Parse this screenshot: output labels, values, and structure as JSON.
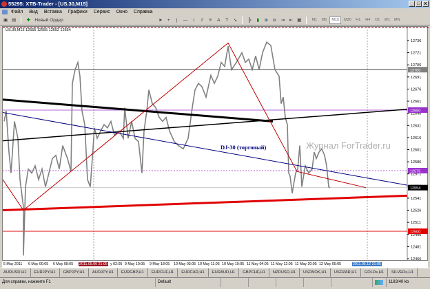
{
  "window": {
    "title": "55295: XTB-Trader - [US.30,M15]",
    "min": "_",
    "max": "□",
    "close": "x"
  },
  "menu": [
    "Файл",
    "Вид",
    "Вставка",
    "Графики",
    "Сервис",
    "Окно",
    "Справка"
  ],
  "toolbar": {
    "new_order": "Новый Ордер",
    "timeframes": [
      "M1",
      "M5",
      "M15",
      "M30",
      "H1",
      "H4",
      "D1",
      "W1",
      "MN"
    ],
    "active_timeframe": "M15"
  },
  "chart": {
    "symbol_info": "US.30,M15  12555 12555 12552 12554",
    "instrument_label": "DJ-30 (торговый)",
    "watermark": "Журнал ForTrader.ru",
    "price_axis": [
      "12736",
      "12721",
      "12706",
      "12691",
      "12676",
      "12661",
      "12646",
      "12631",
      "12616",
      "12601",
      "12586",
      "12571",
      "12556",
      "12541",
      "12526",
      "12511",
      "12496",
      "12481",
      "12466"
    ],
    "price_range": [
      12466,
      12736
    ],
    "level_markers": [
      {
        "price": 12700,
        "label": "12700",
        "color": "#808080",
        "style": "solid"
      },
      {
        "price": 12650,
        "label": "12650",
        "color": "#9932cc",
        "style": "solid"
      },
      {
        "price": 12575,
        "label": "12575",
        "color": "#9932cc",
        "style": "dotted"
      },
      {
        "price": 12554,
        "label": "12554",
        "color": "#c0c0c0",
        "style": "solid",
        "marker": "#000000"
      },
      {
        "price": 12500,
        "label": "12500",
        "color": "#e00000",
        "style": "solid"
      }
    ],
    "time_labels": [
      "5 May 2011",
      "6 May 00:05",
      "6 May 08:05",
      "2011.05.06 21:05",
      "y 02:05",
      "9 May 10:05",
      "9 May 18:05",
      "10 May 03:05",
      "10 May 11:05",
      "10 May 19:05",
      "11 May 04:05",
      "11 May 12:05",
      "11 May 20:05",
      "12 May 05:05",
      "2011.05.12 21:05"
    ],
    "bar_span": 587,
    "vertical_lines": [
      132,
      529
    ],
    "price_series": [
      [
        2,
        12636
      ],
      [
        5,
        12649
      ],
      [
        9,
        12598
      ],
      [
        12,
        12572
      ],
      [
        17,
        12636
      ],
      [
        22,
        12615
      ],
      [
        25,
        12564
      ],
      [
        30,
        12530
      ],
      [
        30,
        12470
      ],
      [
        33,
        12555
      ],
      [
        37,
        12577
      ],
      [
        42,
        12572
      ],
      [
        47,
        12581
      ],
      [
        52,
        12564
      ],
      [
        57,
        12577
      ],
      [
        62,
        12555
      ],
      [
        67,
        12572
      ],
      [
        72,
        12590
      ],
      [
        77,
        12594
      ],
      [
        82,
        12577
      ],
      [
        87,
        12606
      ],
      [
        94,
        12590
      ],
      [
        99,
        12574
      ],
      [
        101,
        12683
      ],
      [
        105,
        12700
      ],
      [
        109,
        12709
      ],
      [
        112,
        12692
      ],
      [
        115,
        12649
      ],
      [
        119,
        12632
      ],
      [
        123,
        12564
      ],
      [
        127,
        12555
      ],
      [
        130,
        12590
      ],
      [
        133,
        12628
      ],
      [
        137,
        12615
      ],
      [
        142,
        12624
      ],
      [
        147,
        12632
      ],
      [
        152,
        12628
      ],
      [
        157,
        12636
      ],
      [
        162,
        12619
      ],
      [
        169,
        12624
      ],
      [
        175,
        12615
      ],
      [
        177,
        12653
      ],
      [
        182,
        12615
      ],
      [
        187,
        12636
      ],
      [
        192,
        12615
      ],
      [
        197,
        12611
      ],
      [
        202,
        12572
      ],
      [
        205,
        12624
      ],
      [
        209,
        12649
      ],
      [
        212,
        12675
      ],
      [
        217,
        12658
      ],
      [
        222,
        12653
      ],
      [
        227,
        12641
      ],
      [
        232,
        12636
      ],
      [
        237,
        12641
      ],
      [
        242,
        12624
      ],
      [
        249,
        12611
      ],
      [
        255,
        12606
      ],
      [
        262,
        12602
      ],
      [
        269,
        12615
      ],
      [
        275,
        12653
      ],
      [
        279,
        12675
      ],
      [
        284,
        12683
      ],
      [
        289,
        12679
      ],
      [
        295,
        12666
      ],
      [
        302,
        12693
      ],
      [
        307,
        12683
      ],
      [
        312,
        12692
      ],
      [
        317,
        12709
      ],
      [
        322,
        12704
      ],
      [
        327,
        12729
      ],
      [
        332,
        12700
      ],
      [
        339,
        12709
      ],
      [
        347,
        12721
      ],
      [
        352,
        12709
      ],
      [
        357,
        12713
      ],
      [
        362,
        12700
      ],
      [
        367,
        12717
      ],
      [
        372,
        12700
      ],
      [
        377,
        12721
      ],
      [
        383,
        12734
      ],
      [
        389,
        12730
      ],
      [
        395,
        12700
      ],
      [
        401,
        12692
      ],
      [
        404,
        12658
      ],
      [
        407,
        12666
      ],
      [
        410,
        12641
      ],
      [
        413,
        12632
      ],
      [
        415,
        12572
      ],
      [
        417,
        12568
      ],
      [
        420,
        12547
      ],
      [
        425,
        12572
      ],
      [
        428,
        12577
      ],
      [
        431,
        12606
      ],
      [
        434,
        12555
      ],
      [
        439,
        12581
      ],
      [
        444,
        12572
      ],
      [
        449,
        12577
      ],
      [
        452,
        12598
      ],
      [
        455,
        12590
      ],
      [
        459,
        12598
      ],
      [
        463,
        12602
      ],
      [
        467,
        12594
      ],
      [
        470,
        12581
      ],
      [
        473,
        12555
      ],
      [
        475,
        12554
      ]
    ],
    "trendlines": [
      {
        "name": "thick-black-resistance",
        "color": "#000000",
        "width": 3,
        "points": [
          [
            0,
            12663
          ],
          [
            392,
            12636
          ]
        ]
      },
      {
        "name": "black-support",
        "color": "#000000",
        "width": 1.5,
        "points": [
          [
            0,
            12612
          ],
          [
            587,
            12651
          ]
        ]
      },
      {
        "name": "navy-trendline",
        "color": "#000080",
        "width": 1,
        "points": [
          [
            0,
            12647
          ],
          [
            587,
            12557
          ]
        ]
      },
      {
        "name": "thick-red-support",
        "color": "#e00000",
        "width": 3,
        "points": [
          [
            0,
            12526
          ],
          [
            587,
            12544
          ]
        ]
      },
      {
        "name": "red-zigzag",
        "color": "#c00000",
        "width": 1,
        "points": [
          [
            0,
            12564
          ],
          [
            30,
            12526
          ],
          [
            327,
            12733
          ],
          [
            427,
            12574
          ],
          [
            527,
            12554
          ]
        ]
      }
    ]
  },
  "tabs": [
    "AUDUSD,H1",
    "EURJPY,H1",
    "GBPJPY,H1",
    "AUDJPY,H1",
    "EURGBP,H1",
    "EURCHF,H1",
    "EURCAD,H1",
    "EURAUD,H1",
    "GBPCHF,H1",
    "NZDUSD,H1",
    "USDNOK,H1",
    "USDZAR,H1",
    "GOLDs,H1",
    "SILVERs,H1"
  ],
  "status": {
    "help": "Для справки, нажмите F1",
    "profile": "Default",
    "traffic": "1183/40 kb"
  }
}
